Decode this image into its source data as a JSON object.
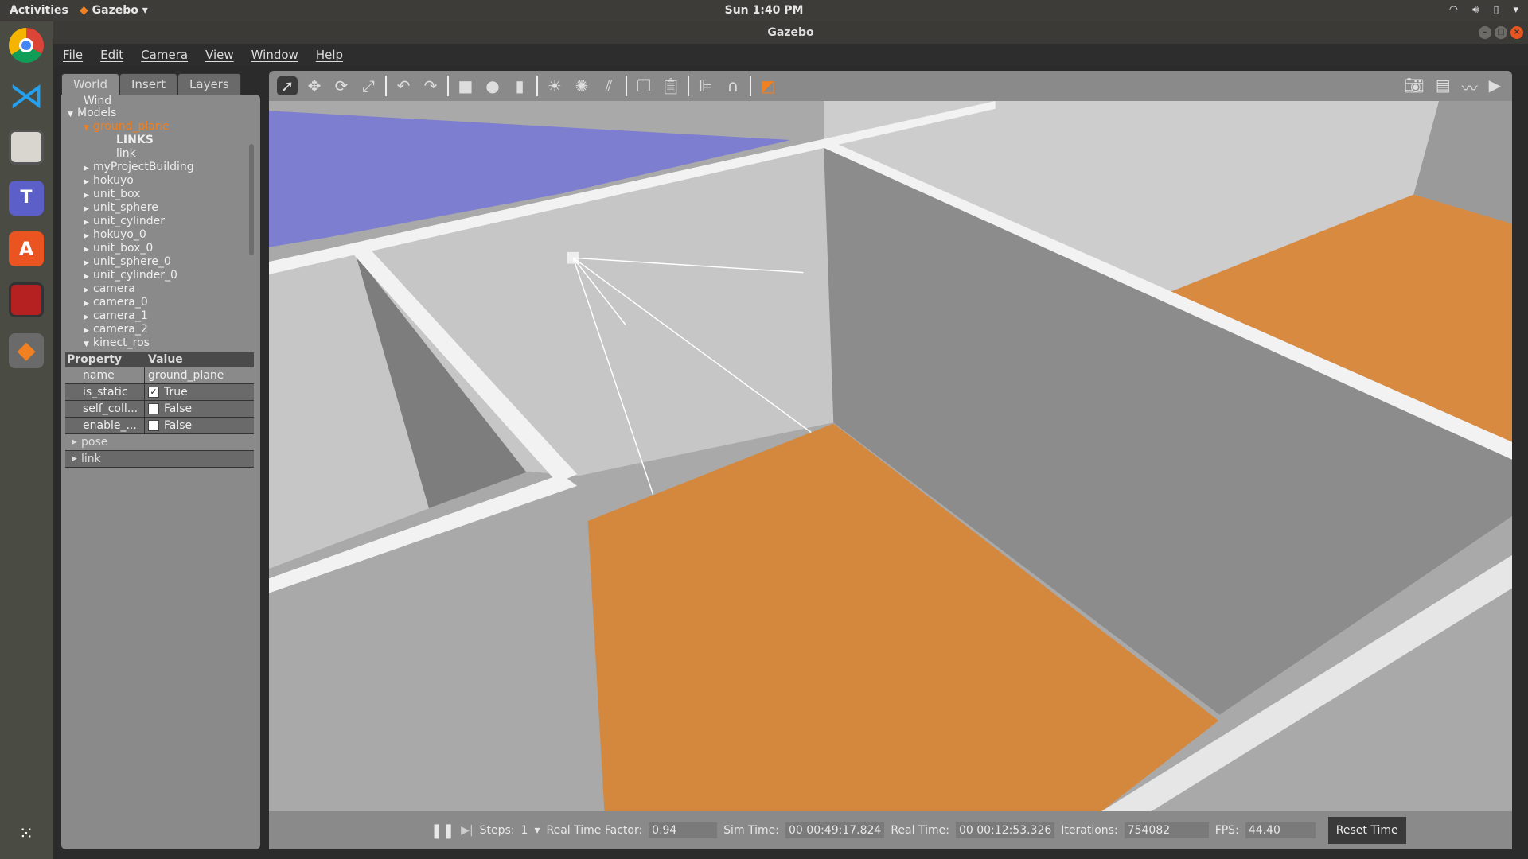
{
  "topbar": {
    "activities": "Activities",
    "app": "Gazebo",
    "clock": "Sun  1:40 PM",
    "tray": [
      "wifi-icon",
      "volume-icon",
      "battery-icon",
      "menu-arrow-icon"
    ]
  },
  "dock": [
    "chrome",
    "vscode",
    "files",
    "teams",
    "software-center",
    "terminal-app",
    "gazebo",
    "show-apps"
  ],
  "window": {
    "title": "Gazebo"
  },
  "menu": [
    "File",
    "Edit",
    "Camera",
    "View",
    "Window",
    "Help"
  ],
  "left": {
    "tabs": [
      "World",
      "Insert",
      "Layers"
    ],
    "tree": {
      "partial": "Wind",
      "models": "Models",
      "selected": "ground_plane",
      "links_header": "LINKS",
      "link": "link",
      "items": [
        "myProjectBuilding",
        "hokuyo",
        "unit_box",
        "unit_sphere",
        "unit_cylinder",
        "hokuyo_0",
        "unit_box_0",
        "unit_sphere_0",
        "unit_cylinder_0",
        "camera",
        "camera_0",
        "camera_1",
        "camera_2"
      ],
      "expanded_last": "kinect_ros"
    },
    "props": {
      "header": [
        "Property",
        "Value"
      ],
      "rows": [
        {
          "k": "name",
          "v": "ground_plane"
        },
        {
          "k": "is_static",
          "v": "True",
          "checked": true
        },
        {
          "k": "self_coll...",
          "v": "False",
          "checked": false
        },
        {
          "k": "enable_...",
          "v": "False",
          "checked": false
        }
      ],
      "groups": [
        "pose",
        "link"
      ]
    }
  },
  "toolbar": {
    "tools": [
      "select-icon",
      "translate-icon",
      "rotate-icon",
      "scale-icon",
      "undo-icon",
      "redo-icon",
      "box-icon",
      "sphere-icon",
      "cylinder-icon",
      "point-light-icon",
      "spot-light-icon",
      "directional-light-icon",
      "copy-icon",
      "paste-icon",
      "align-icon",
      "snap-icon",
      "view-angle-icon"
    ],
    "right": [
      "screenshot-icon",
      "log-icon",
      "plot-icon",
      "record-video-icon"
    ]
  },
  "status": {
    "steps_label": "Steps:",
    "steps": "1",
    "rtf_label": "Real Time Factor:",
    "rtf": "0.94",
    "sim_label": "Sim Time:",
    "sim": "00 00:49:17.824",
    "real_label": "Real Time:",
    "real": "00 00:12:53.326",
    "iter_label": "Iterations:",
    "iter": "754082",
    "fps_label": "FPS:",
    "fps": "44.40",
    "reset": "Reset Time"
  },
  "colors": {
    "selected": "#f08020",
    "wood": "#d4883e",
    "close": "#e9541f"
  }
}
